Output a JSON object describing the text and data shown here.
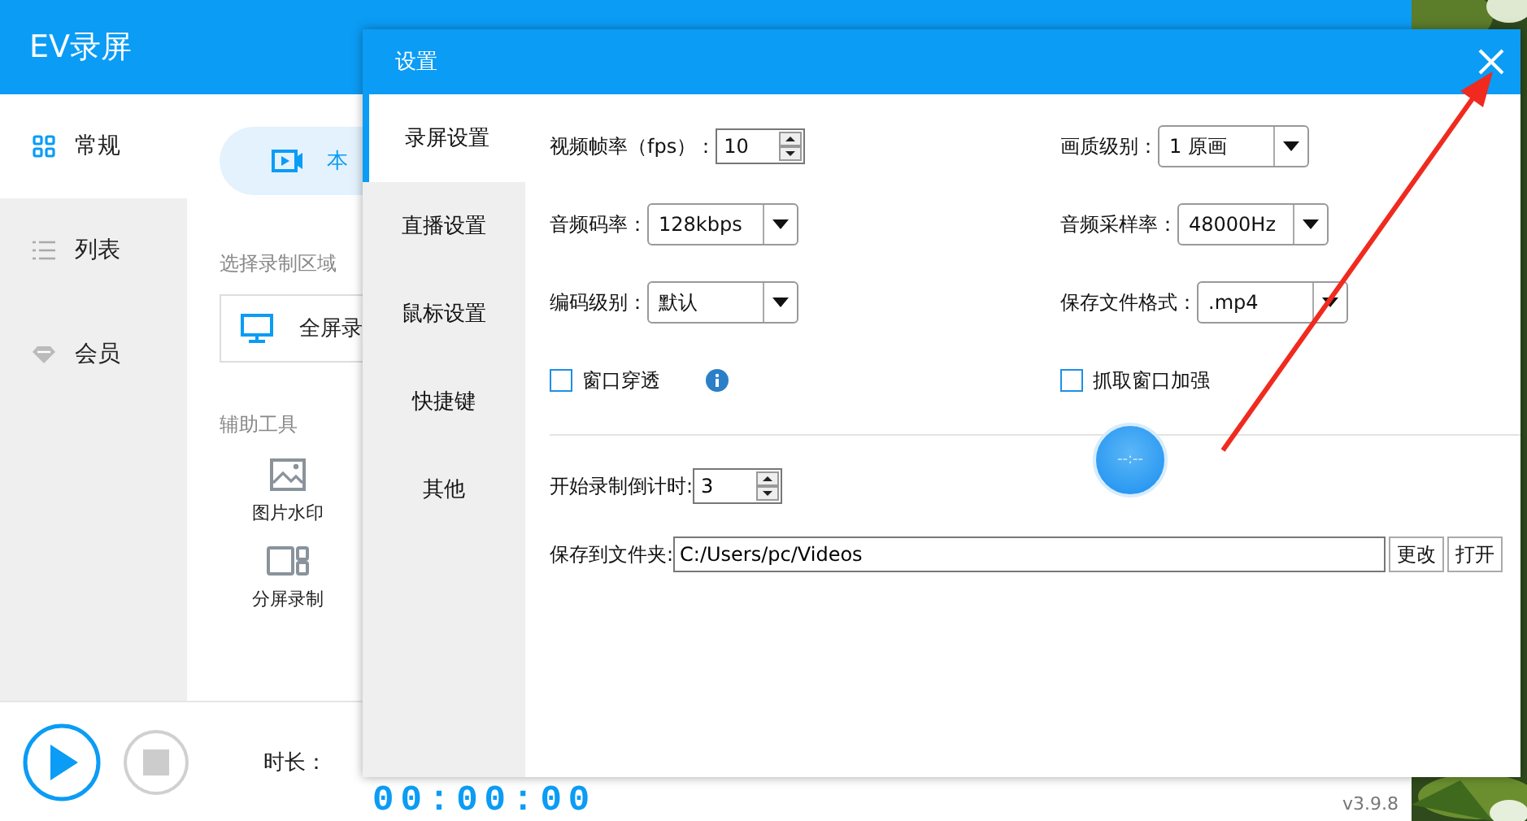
{
  "app": {
    "title": "EV录屏",
    "version": "v3.9.8"
  },
  "sidebar": {
    "items": [
      {
        "label": "常规",
        "selected": true
      },
      {
        "label": "列表",
        "selected": false
      },
      {
        "label": "会员",
        "selected": false
      }
    ]
  },
  "content": {
    "mode_tab": "本",
    "region_heading": "选择录制区域",
    "region_card": "全屏录",
    "tools_heading": "辅助工具",
    "tools": [
      "图片水印",
      "分屏录制"
    ]
  },
  "bottom_bar": {
    "duration_label": "时长：",
    "timer": "00:00:00"
  },
  "settings_dialog": {
    "title": "设置",
    "nav": [
      {
        "label": "录屏设置",
        "selected": true
      },
      {
        "label": "直播设置",
        "selected": false
      },
      {
        "label": "鼠标设置",
        "selected": false
      },
      {
        "label": "快捷键",
        "selected": false
      },
      {
        "label": "其他",
        "selected": false
      }
    ],
    "left_fields": [
      {
        "kind": "spinner",
        "label": "视频帧率（fps）：",
        "value": "10"
      },
      {
        "kind": "dropdown",
        "label": "音频码率：",
        "value": "128kbps"
      },
      {
        "kind": "dropdown",
        "label": "编码级别：",
        "value": "默认"
      },
      {
        "kind": "checkbox",
        "label": "窗口穿透",
        "checked": false,
        "info_icon": true
      }
    ],
    "right_fields": [
      {
        "kind": "dropdown",
        "label": "画质级别：",
        "value": "1 原画"
      },
      {
        "kind": "dropdown",
        "label": "音频采样率：",
        "value": "48000Hz"
      },
      {
        "kind": "dropdown",
        "label": "保存文件格式：",
        "value": ".mp4"
      },
      {
        "kind": "checkbox",
        "label": "抓取窗口加强",
        "checked": false
      }
    ],
    "countdown": {
      "label": "开始录制倒计时:",
      "value": "3"
    },
    "save_folder": {
      "label": "保存到文件夹:",
      "value": "C:/Users/pc/Videos",
      "buttons": [
        "更改",
        "打开"
      ]
    },
    "loading_badge": "--:--"
  }
}
